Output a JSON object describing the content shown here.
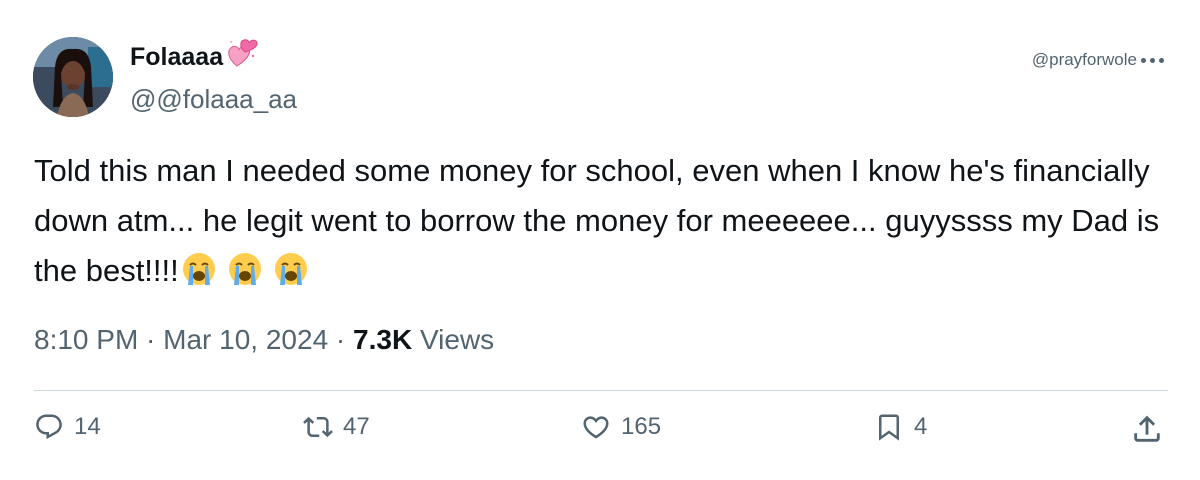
{
  "tweet": {
    "display_name": "Folaaaa",
    "handle": "@@folaaa_aa",
    "watermark": "@prayforwole",
    "text": "Told this man I needed some money for school, even when I know he's financially down atm... he legit went to borrow the money for meeeeee... guyyssss my Dad is the best!!!!",
    "timestamp": "8:10 PM · Mar 10, 2024 · ",
    "views_count": "7.3K",
    "views_label": " Views"
  },
  "actions": {
    "replies": "14",
    "reposts": "47",
    "likes": "165",
    "bookmarks": "4"
  },
  "icons": {
    "name_emoji": "sparkling-heart-icon",
    "text_emojis": [
      "loudly-crying-face-icon",
      "loudly-crying-face-icon",
      "loudly-crying-face-icon"
    ]
  },
  "colors": {
    "text_primary": "#0f1419",
    "text_secondary": "#536471",
    "divider": "#cfd9de",
    "heart_pink": "#f7a1c4"
  }
}
